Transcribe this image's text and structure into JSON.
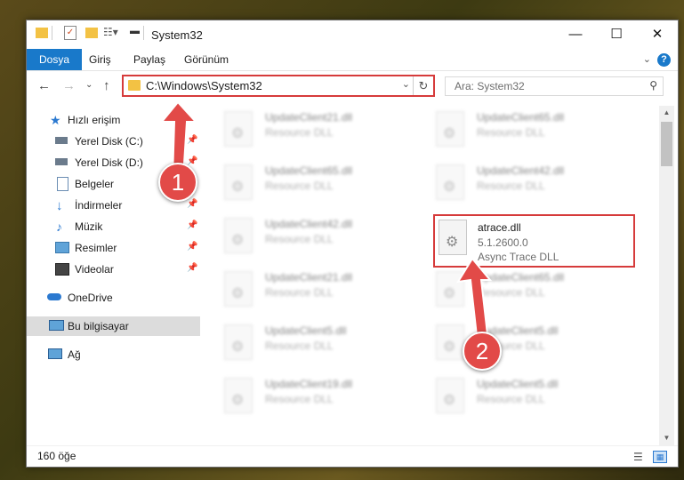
{
  "window": {
    "title": "System32",
    "controls": {
      "minimize": "—",
      "maximize": "☐",
      "close": "✕"
    }
  },
  "ribbon": {
    "tabs": [
      "Dosya",
      "Giriş",
      "Paylaş",
      "Görünüm"
    ],
    "active_tab": "Dosya",
    "help": "?"
  },
  "address": {
    "path": "C:\\Windows\\System32",
    "search_placeholder": "Ara: System32"
  },
  "nav": {
    "items": [
      {
        "label": "Hızlı erişim",
        "icon": "star-icon",
        "pinned": false
      },
      {
        "label": "Yerel Disk (C:)",
        "icon": "drive-icon",
        "pinned": true
      },
      {
        "label": "Yerel Disk (D:)",
        "icon": "drive-icon",
        "pinned": true
      },
      {
        "label": "Belgeler",
        "icon": "documents-icon",
        "pinned": true
      },
      {
        "label": "İndirmeler",
        "icon": "download-icon",
        "pinned": true
      },
      {
        "label": "Müzik",
        "icon": "music-icon",
        "pinned": true
      },
      {
        "label": "Resimler",
        "icon": "pictures-icon",
        "pinned": true
      },
      {
        "label": "Videolar",
        "icon": "videos-icon",
        "pinned": true
      },
      {
        "label": "OneDrive",
        "icon": "cloud-icon",
        "pinned": false
      },
      {
        "label": "Bu bilgisayar",
        "icon": "computer-icon",
        "pinned": false
      },
      {
        "label": "Ağ",
        "icon": "network-icon",
        "pinned": false
      }
    ],
    "selected": "Bu bilgisayar"
  },
  "files": [
    {
      "name": "UpdateClient21.dll",
      "desc": "Resource DLL",
      "blurred": true
    },
    {
      "name": "UpdateClient65.dll",
      "desc": "Resource DLL",
      "blurred": true
    },
    {
      "name": "UpdateClient65.dll",
      "desc": "Resource DLL",
      "blurred": true
    },
    {
      "name": "UpdateClient42.dll",
      "desc": "Resource DLL",
      "blurred": true
    },
    {
      "name": "UpdateClient42.dll",
      "desc": "Resource DLL",
      "blurred": true
    },
    {
      "name": "atrace.dll",
      "version": "5.1.2600.0",
      "desc": "Async Trace DLL",
      "blurred": false,
      "highlighted": true
    },
    {
      "name": "UpdateClient21.dll",
      "desc": "Resource DLL",
      "blurred": true
    },
    {
      "name": "UpdateClient65.dll",
      "desc": "Resource DLL",
      "blurred": true
    },
    {
      "name": "UpdateClient5.dll",
      "desc": "Resource DLL",
      "blurred": true
    },
    {
      "name": "UpdateClient5.dll",
      "desc": "Resource DLL",
      "blurred": true
    },
    {
      "name": "UpdateClient19.dll",
      "desc": "Resource DLL",
      "blurred": true
    },
    {
      "name": "UpdateClient5.dll",
      "desc": "Resource DLL",
      "blurred": true
    }
  ],
  "status": {
    "count": "160 öğe"
  },
  "callouts": [
    "1",
    "2"
  ],
  "colors": {
    "accent": "#1979ca",
    "highlight": "#d63b3b",
    "callout": "#e24a48"
  }
}
